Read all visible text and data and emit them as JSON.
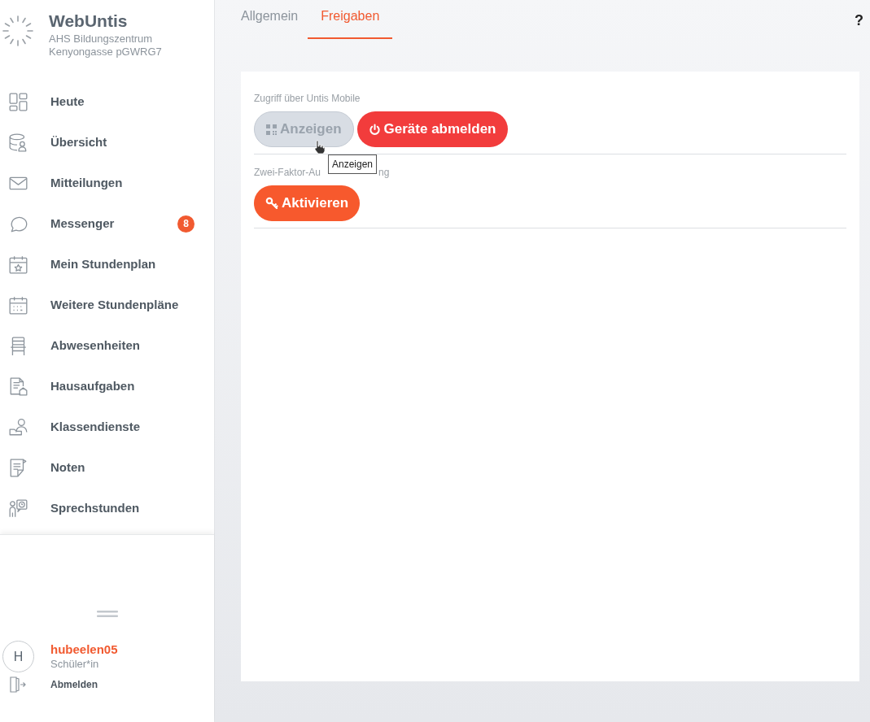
{
  "brand": {
    "title": "WebUntis",
    "school_line_1": "AHS Bildungszentrum",
    "school_line_2": "Kenyongasse pGWRG7"
  },
  "nav": [
    {
      "label": "Heute"
    },
    {
      "label": "Übersicht"
    },
    {
      "label": "Mitteilungen"
    },
    {
      "label": "Messenger",
      "badge": "8"
    },
    {
      "label": "Mein Stundenplan"
    },
    {
      "label": "Weitere Stundenpläne"
    },
    {
      "label": "Abwesenheiten"
    },
    {
      "label": "Hausaufgaben"
    },
    {
      "label": "Klassendienste"
    },
    {
      "label": "Noten"
    },
    {
      "label": "Sprechstunden"
    }
  ],
  "user": {
    "avatar_letter": "H",
    "name": "hubeelen05",
    "role": "Schüler*in",
    "logout": "Abmelden"
  },
  "tabs": [
    {
      "label": "Allgemein",
      "selected": false
    },
    {
      "label": "Freigaben",
      "selected": true
    }
  ],
  "help": "?",
  "sections": [
    {
      "label_parts": [
        "Zugriff über Untis Mobile"
      ],
      "buttons": [
        {
          "kind": "show",
          "label": "Anzeigen",
          "disabled": true
        },
        {
          "kind": "power",
          "label": "Geräte abmelden",
          "disabled": false
        }
      ]
    },
    {
      "label_parts": [
        "Zwei-Faktor-Au",
        "ng"
      ],
      "buttons": [
        {
          "kind": "key",
          "label": "Aktivieren",
          "disabled": false
        }
      ]
    }
  ],
  "tooltip": "Anzeigen"
}
